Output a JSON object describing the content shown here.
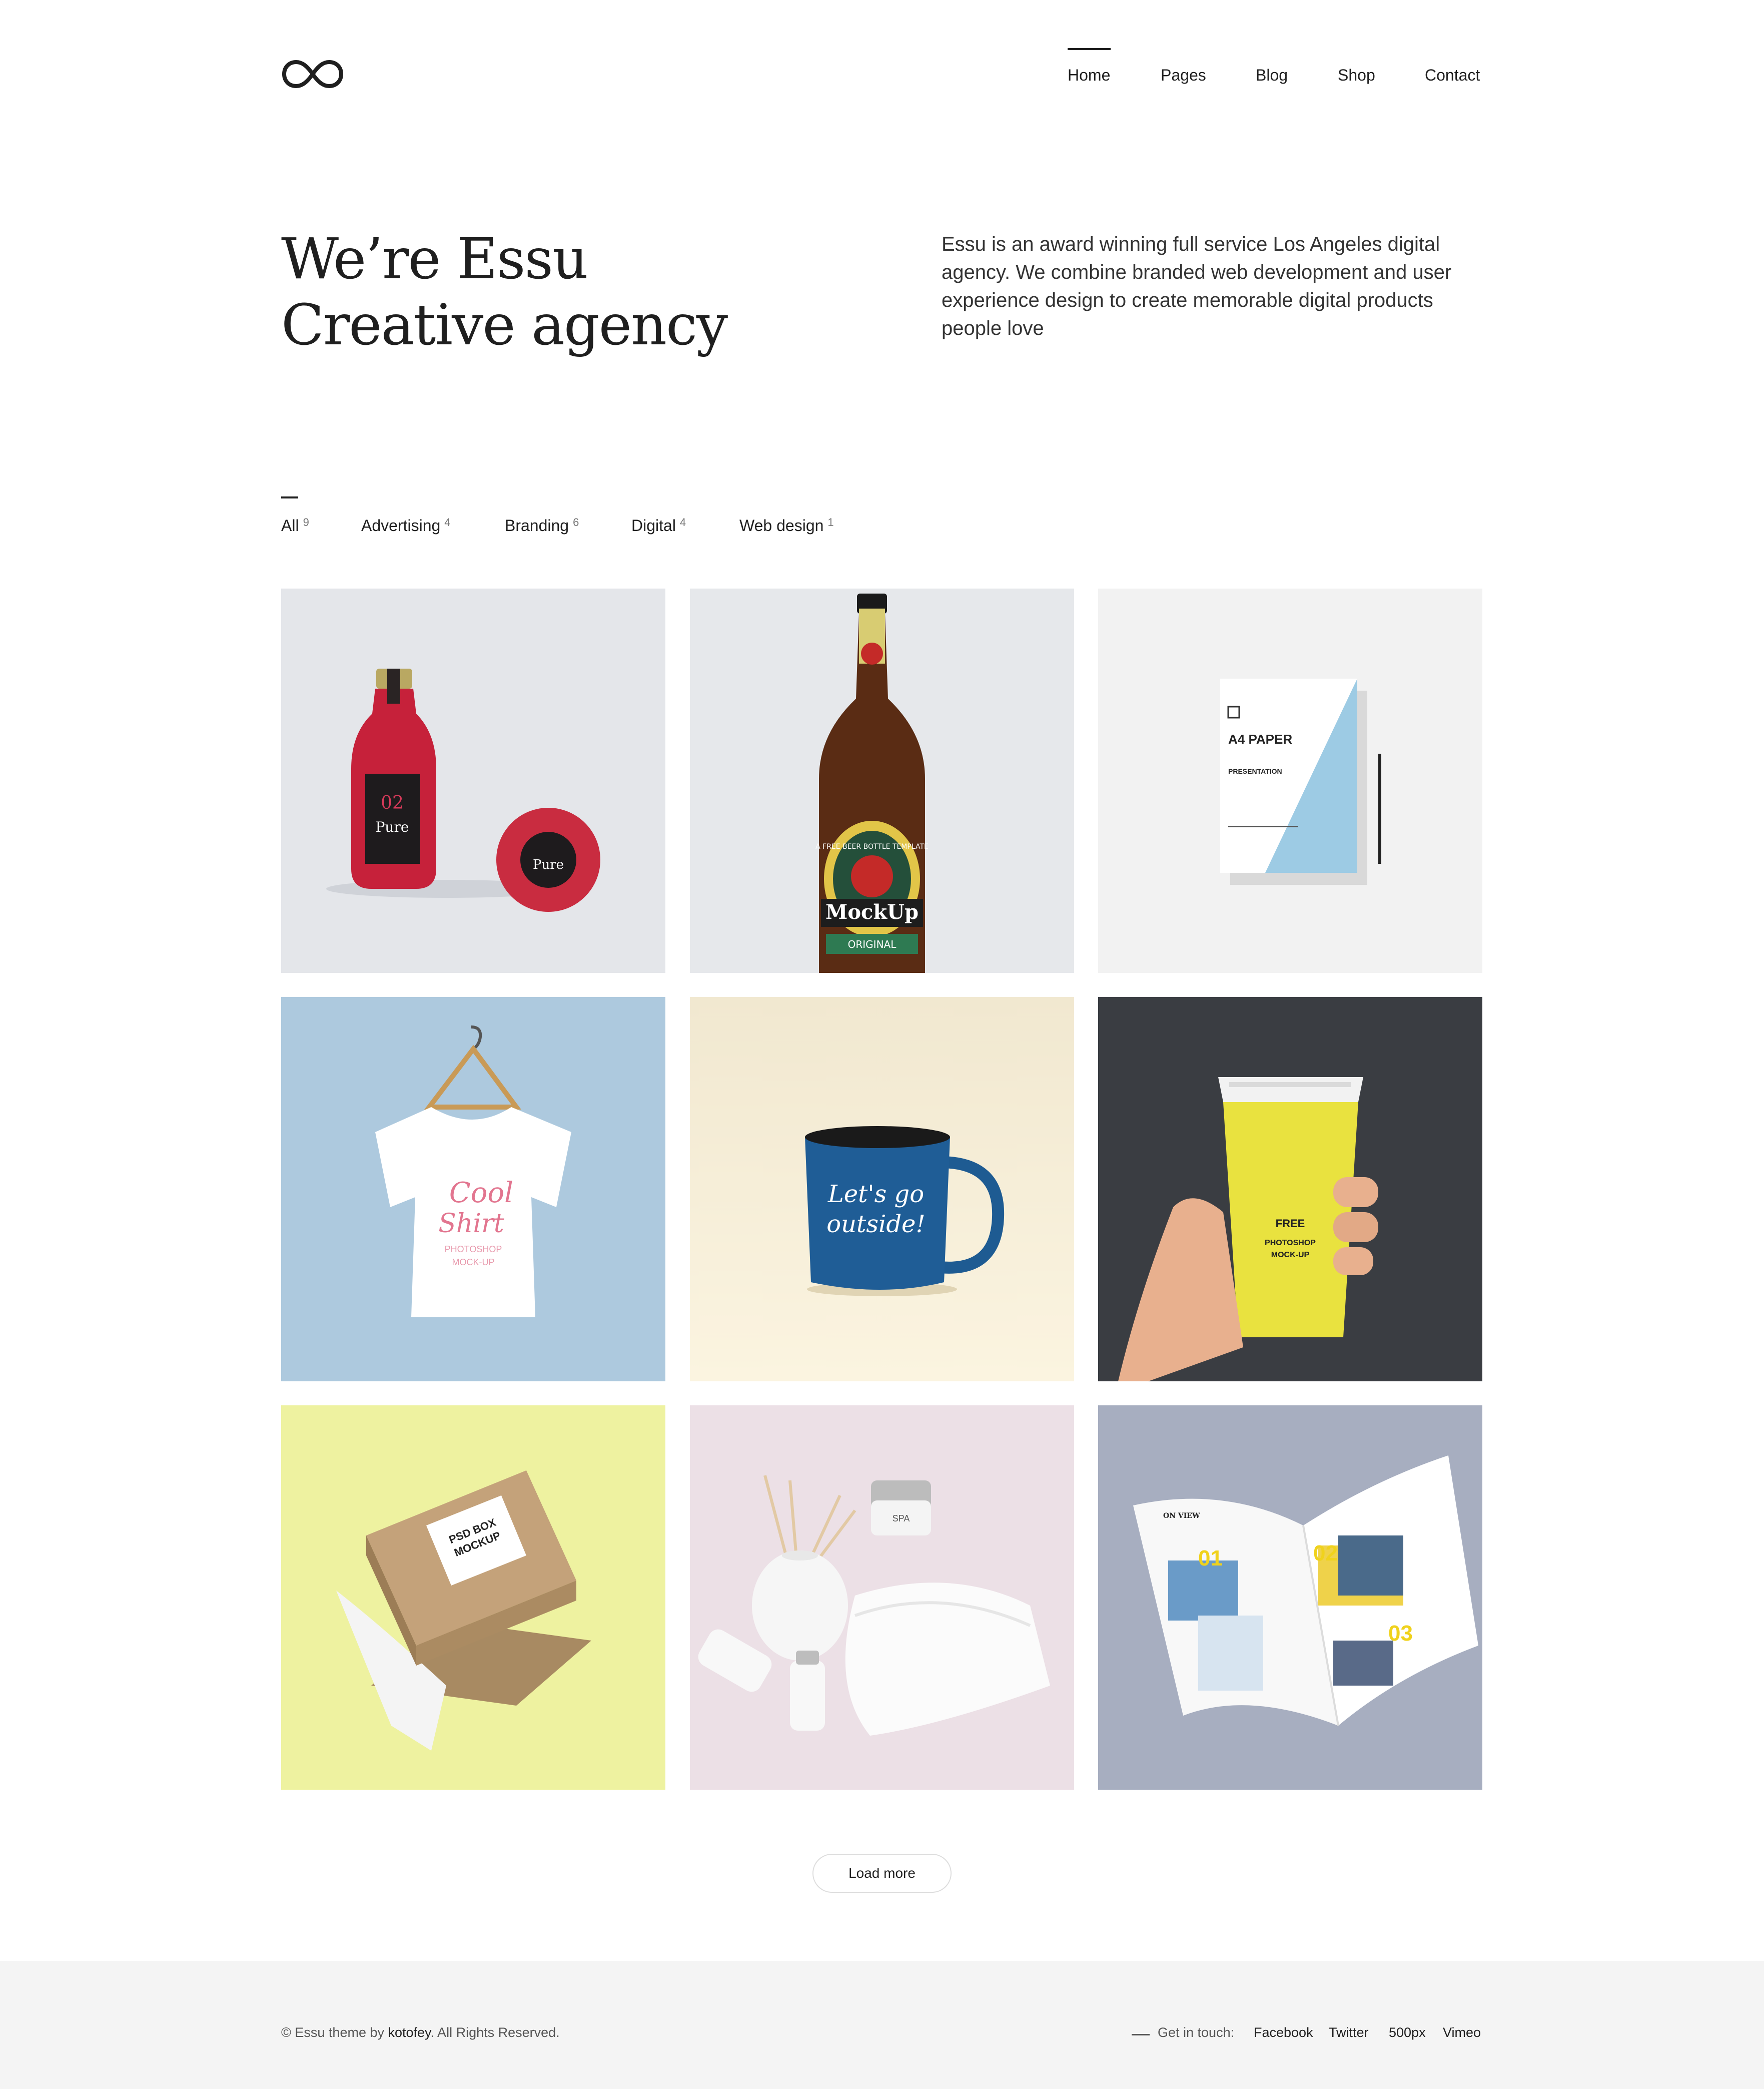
{
  "header": {
    "nav": [
      {
        "label": "Home",
        "active": true
      },
      {
        "label": "Pages"
      },
      {
        "label": "Blog"
      },
      {
        "label": "Shop"
      },
      {
        "label": "Contact"
      }
    ]
  },
  "hero": {
    "title_line1": "We’re Essu",
    "title_line2": "Creative agency",
    "description": "Essu is an award winning full service Los Angeles digital agency. We combine branded web development and user experience design to create memorable digital products people love"
  },
  "filters": [
    {
      "label": "All",
      "count": "9",
      "active": true
    },
    {
      "label": "Advertising",
      "count": "4"
    },
    {
      "label": "Branding",
      "count": "6"
    },
    {
      "label": "Digital",
      "count": "4"
    },
    {
      "label": "Web design",
      "count": "1"
    }
  ],
  "portfolio": [
    {
      "name": "jar-bottle-mockup",
      "background": "#e4e6ea",
      "text": [
        "02",
        "Pure"
      ]
    },
    {
      "name": "beer-bottle-mockup",
      "background": "#e6e8eb",
      "text": [
        "MockUp",
        "A FREE BEER BOTTLE TEMPLATE",
        "ORIGINAL"
      ]
    },
    {
      "name": "a4-paper-mockup",
      "background": "#f2f2f2",
      "text": [
        "A4 PAPER",
        "PRESENTATION"
      ]
    },
    {
      "name": "tshirt-mockup",
      "background": "#adc9de",
      "text": [
        "Cool",
        "Shirt",
        "PHOTOSHOP",
        "MOCK-UP"
      ]
    },
    {
      "name": "mug-mockup",
      "background": "#f3ead2",
      "text": [
        "Let's go",
        "outside!"
      ]
    },
    {
      "name": "coffee-cup-mockup",
      "background": "#3a3d42",
      "text": [
        "FREE",
        "PHOTOSHOP",
        "MOCK-UP"
      ]
    },
    {
      "name": "box-mockup",
      "background": "#eef2a0",
      "text": [
        "PSD BOX",
        "MOCKUP"
      ]
    },
    {
      "name": "spa-mockup",
      "background": "#ece0e6",
      "text": [
        "SPA"
      ]
    },
    {
      "name": "magazine-mockup",
      "background": "#a7aec0",
      "text": [
        "01",
        "02",
        "03",
        "ON VIEW"
      ]
    }
  ],
  "load_more": "Load more",
  "footer": {
    "copy_prefix": "© Essu theme by ",
    "copy_author": "kotofey",
    "copy_suffix": ". All Rights Reserved.",
    "get_in_touch": "Get in touch:",
    "social": [
      "Facebook",
      "Twitter",
      "500px",
      "Vimeo"
    ]
  },
  "colors": {
    "text": "#1f1f1f",
    "footer_bg": "#f4f4f4",
    "accent_yellow": "#f0d21c"
  }
}
